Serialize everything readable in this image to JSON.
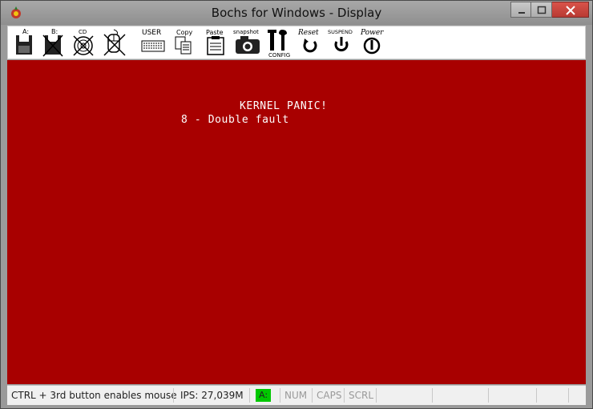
{
  "window": {
    "title": "Bochs for Windows - Display"
  },
  "toolbar": {
    "floppy_a_label": "A:",
    "floppy_b_label": "B:",
    "cdrom_label": "CD",
    "user_label": "USER",
    "copy_label": "Copy",
    "paste_label": "Paste",
    "snapshot_label": "snapshot",
    "config_label": "CONFIG",
    "reset_label": "Reset",
    "suspend_label": "SUSPEND",
    "power_label": "Power"
  },
  "screen": {
    "background": "#a80000",
    "lines": [
      "KERNEL PANIC!",
      "8 - Double fault"
    ]
  },
  "statusbar": {
    "mouse_hint": "CTRL + 3rd button enables mouse",
    "ips": "IPS: 27,039M",
    "drive_indicator": "A:",
    "num": "NUM",
    "caps": "CAPS",
    "scrl": "SCRL"
  }
}
